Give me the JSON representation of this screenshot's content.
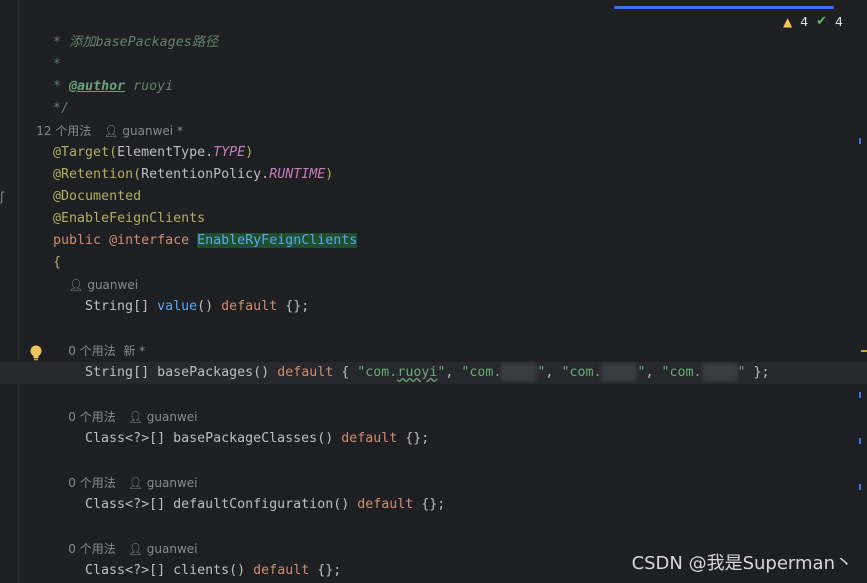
{
  "editor": {
    "inspections": {
      "warnings": "4",
      "weak_warnings": "4"
    },
    "lines": {
      "c1": "* 添加basePackages路径",
      "c2": "*",
      "c3_star": "* ",
      "c3_tag": "@author",
      "c3_val": " ruoyi",
      "c4": "*/",
      "hint1_usages": "12 个用法",
      "hint1_author": "guanwei *",
      "a1_anno": "@Target(",
      "a1_type": "ElementType.",
      "a1_const": "TYPE",
      "a1_end": ")",
      "a2_anno": "@Retention(",
      "a2_type": "RetentionPolicy.",
      "a2_const": "RUNTIME",
      "a2_end": ")",
      "a3": "@Documented",
      "a4": "@EnableFeignClients",
      "decl_kw": "public ",
      "decl_anno": "@interface ",
      "decl_name": "EnableRyFeignClients",
      "brace_open": "{",
      "hint_value_author": "guanwei",
      "m1_type": "String[] ",
      "m1_name": "value",
      "m1_paren": "() ",
      "m1_kw": "default",
      "m1_val": " {};",
      "hint2_usages": "0 个用法",
      "hint2_author": "新 *",
      "m2_type": "String[] ",
      "m2_name": "basePackages",
      "m2_paren": "() ",
      "m2_kw": "default",
      "m2_open": " { ",
      "m2_s1a": "\"com.",
      "m2_s1b": "ruoyi",
      "m2_s1c": "\"",
      "m2_sep": ", ",
      "m2_s2a": "\"com.",
      "m2_s2c": "\"",
      "m2_s3a": "\"com.",
      "m2_s3c": "\"",
      "m2_s4a": "\"com.",
      "m2_s4c": "\"",
      "m2_close": " };",
      "hint3_usages": "0 个用法",
      "hint3_author": "guanwei",
      "m3_type": "Class<?>[] ",
      "m3_name": "basePackageClasses",
      "m3_paren": "() ",
      "m3_kw": "default",
      "m3_val": " {};",
      "hint4_usages": "0 个用法",
      "hint4_author": "guanwei",
      "m4_type": "Class<?>[] ",
      "m4_name": "defaultConfiguration",
      "m4_paren": "() ",
      "m4_kw": "default",
      "m4_val": " {};",
      "hint5_usages": "0 个用法",
      "hint5_author": "guanwei",
      "m5_type": "Class<?>[] ",
      "m5_name": "clients",
      "m5_paren": "() ",
      "m5_kw": "default",
      "m5_val": " {};",
      "brace_close": "}"
    }
  },
  "watermark": "CSDN @我是Superman丶",
  "icons": {
    "warning": "warning-icon",
    "check": "double-check-icon",
    "bulb": "lightbulb-icon",
    "person": "person-icon",
    "gutter_mark": "implementation-gutter-icon"
  }
}
